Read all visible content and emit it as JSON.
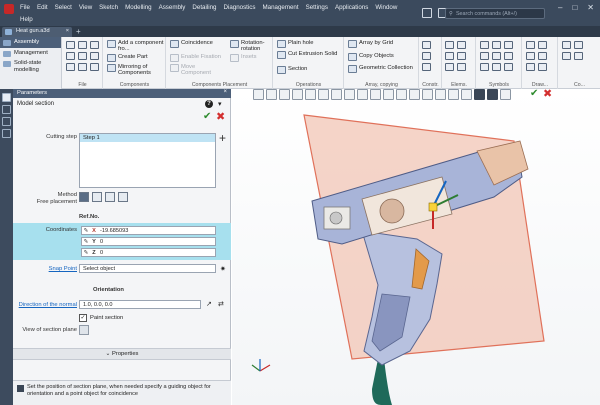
{
  "menu": {
    "items": [
      "File",
      "Edit",
      "Select",
      "View",
      "Sketch",
      "Modelling",
      "Assembly",
      "Detailing",
      "Diagnostics",
      "Management",
      "Settings",
      "Applications",
      "Window"
    ],
    "row2": "Help"
  },
  "search": {
    "placeholder": "Search commands (Alt+/)"
  },
  "document_tab": {
    "label": "Heat gun.a3d"
  },
  "ribbon_nav": {
    "items": [
      {
        "label": "Assembly",
        "active": true
      },
      {
        "label": "Management",
        "active": false
      },
      {
        "label": "Solid-state modelling",
        "active": false
      }
    ]
  },
  "ribbon": {
    "buttons": {
      "add_component": "Add a component fro...",
      "create_part": "Create Part",
      "mirroring": "Mirroring of Components",
      "coincidence": "Coincidence",
      "enable_fixation": "Enable Fixation",
      "move_component": "Move Component",
      "rotation": "Rotation-rotation",
      "insets": "Insets",
      "plain_hole": "Plain hole",
      "cut_extrusion": "Cut Extrusion Solid",
      "section": "Section",
      "array_grid": "Array by Grid",
      "copy_objects": "Copy Objects",
      "geometric_collection": "Geometric Collection"
    },
    "section_captions": [
      "File",
      "Components",
      "Components Placement",
      "Operations",
      "Array, copying",
      "Constr.",
      "Elems.",
      "Symbols",
      "Draw...",
      "Co..."
    ]
  },
  "panel": {
    "header": "Parameters",
    "subheader": "Model section",
    "help_symbol": "?",
    "cutting_step_label": "Cutting step",
    "steps": [
      "Step 1"
    ],
    "method_label": "Method",
    "free_placement_label": "Free placement",
    "ref_no_label": "Ref.No.",
    "coordinates_label": "Coordinates",
    "coords": [
      {
        "axis": "X",
        "value": "-19.685093"
      },
      {
        "axis": "Y",
        "value": "0"
      },
      {
        "axis": "Z",
        "value": "0"
      }
    ],
    "snap_point_label": "Snap Point",
    "snap_point_value": "Select object",
    "orientation_label": "Orientation",
    "direction_label": "Direction of the normal",
    "direction_value": "1.0, 0.0, 0.0",
    "paint_section_label": "Paint section",
    "paint_section_checked": true,
    "view_plane_label": "View of section plane",
    "properties_label": "Properties",
    "hint": "Set the position of section plane, when needed specify a guiding object for orientation and a point object for coincidence"
  },
  "icons": {
    "ok": "checkmark-icon",
    "cancel": "close-icon",
    "help": "help-icon",
    "add": "plus-icon",
    "pencil": "pencil-icon",
    "snap": "target-icon",
    "pick_direction": "pick-direction-icon",
    "swap": "swap-icon"
  },
  "colors": {
    "titlebar": "#3b4a5d",
    "panel_header": "#4c5f79",
    "selection": "#a7e0ee",
    "section_plane": "#e9a18c",
    "model_shell": "#a8b4d8",
    "ok_green": "#2e8b2e",
    "cancel_red": "#d32f2f"
  }
}
